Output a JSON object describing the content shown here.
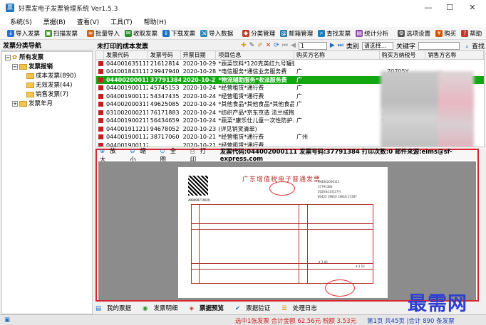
{
  "app_title": "好票发电子发票管理系统 Ver1.5.3",
  "window_controls": {
    "minimize": "—",
    "maximize": "☐",
    "close": "✕"
  },
  "menu": [
    "系统(S)",
    "票据(B)",
    "查看(V)",
    "工具(T)",
    "帮助(H)"
  ],
  "toolbar": [
    {
      "label": "导入发票",
      "color": "#2a6fd1"
    },
    {
      "label": "扫描发票",
      "color": "#3e8f2b"
    },
    {
      "label": "批量导入",
      "color": "#c7621a"
    },
    {
      "label": "收取发票",
      "color": "#2f8f2f"
    },
    {
      "label": "下载发票",
      "color": "#1c6fc4"
    },
    {
      "label": "导入数据",
      "color": "#2f86b8"
    },
    {
      "label": "分类管理",
      "color": "#c0392b"
    },
    {
      "label": "邮箱管理",
      "color": "#2874a6"
    },
    {
      "label": "查找发票",
      "color": "#1d7fbf"
    },
    {
      "label": "统计分析",
      "color": "#8e44ad"
    },
    {
      "label": "选项设置",
      "color": "#555555"
    },
    {
      "label": "购买",
      "color": "#d35400"
    },
    {
      "label": "帮助",
      "color": "#c0392b"
    }
  ],
  "left_panel": {
    "title": "发票分类导航",
    "tree": [
      {
        "label": "所有发票",
        "level": 0,
        "bold": true,
        "expander": "−"
      },
      {
        "label": "发票报销",
        "level": 1,
        "bold": true,
        "expander": "−"
      },
      {
        "label": "成本发票(890)",
        "level": 2,
        "bold": false,
        "expander": ""
      },
      {
        "label": "无效发票(44)",
        "level": 2,
        "bold": false,
        "expander": ""
      },
      {
        "label": "销售发票(7)",
        "level": 2,
        "bold": false,
        "expander": ""
      },
      {
        "label": "发票年月",
        "level": 1,
        "bold": false,
        "expander": "+"
      }
    ]
  },
  "grid_panel": {
    "title": "未打印的成本发票",
    "page_value": "1",
    "category_label": "类别",
    "category_value": "请选择...",
    "keyword_label": "关键字",
    "search_label": "查找"
  },
  "table": {
    "headers": [
      "发票代码",
      "发票号码",
      "开票日期",
      "项目信息",
      "购买方名称",
      "购买方纳税号",
      "销售方名称"
    ],
    "rows": [
      [
        "044001635111",
        "21612814",
        "2020-10-29",
        "*蔬菜饮料*120克英红九号罐装...",
        "",
        "",
        ""
      ],
      [
        "044001843111",
        "29947940",
        "2020-10-28",
        "*电信服务*通信业务服务费",
        "广",
        "...70705Y",
        ""
      ],
      [
        "044002000111",
        "37791384",
        "2020-10-27",
        "*物流辅助服务*收派服务费",
        "广",
        "",
        ""
      ],
      [
        "044001900112",
        "45745153",
        "2020-10-24",
        "*经营租赁*通行费",
        "广",
        "",
        ""
      ],
      [
        "044001900112",
        "54347435",
        "2020-10-24",
        "*经营租赁*通行费",
        "广",
        "",
        ""
      ],
      [
        "044002000311",
        "49625085",
        "2020-10-24",
        "*其他食品*其他食品*其他食品",
        "广",
        "...70705Y",
        ""
      ],
      [
        "031002000211",
        "76171883",
        "2020-10-24",
        "*纺织产品*京东京造 法兰绒抱...",
        "",
        "...70705Y",
        ""
      ],
      [
        "044001900211",
        "56434659",
        "2020-10-24",
        "*蔬菜*康乐仕儿童一次性防护...",
        "广",
        "9144010...",
        ""
      ],
      [
        "044001911211",
        "94678052",
        "2020-10-23",
        "(详见销货清单)",
        "",
        "",
        ""
      ],
      [
        "044001900112",
        "38717060",
        "2020-10-21",
        "*经营租赁*通行费",
        "广州",
        "",
        ""
      ],
      [
        "044001900112",
        "",
        "2020-10-21",
        "*经营租赁*通行费",
        "",
        "",
        ""
      ]
    ]
  },
  "preview": {
    "zoom_in": "放大",
    "zoom_out": "缩小",
    "full_page": "全图",
    "print": "打印",
    "info": "发票代码:044002000111 发票号码:37791384 打印次数:0 邮件来源:eims@sf-express.com",
    "invoice_title": "广东增值税电子普通发票",
    "machine_no": "499099774029",
    "code": "044002000111",
    "number": "37791384",
    "date": "2020年10月27日",
    "check": "80425 39810 19810 27287",
    "amount": "¥ 3.00",
    "total": "¥ 3.53"
  },
  "bottom_tabs": [
    "我的票据",
    "发票明细",
    "票据预览",
    "票据验证",
    "处理日志"
  ],
  "status": {
    "middle": "选中1张发票 合计金额 62.56元 税额 3.53元",
    "right": "第1页 共45页 |合计 890 条发票"
  },
  "watermark": "最需网",
  "colors": {
    "selected_row": "#12a812",
    "preview_border": "#d7262c",
    "invoice_red": "#b4302a",
    "status_red": "#d71d1d",
    "status_blue": "#1c3fb5"
  }
}
